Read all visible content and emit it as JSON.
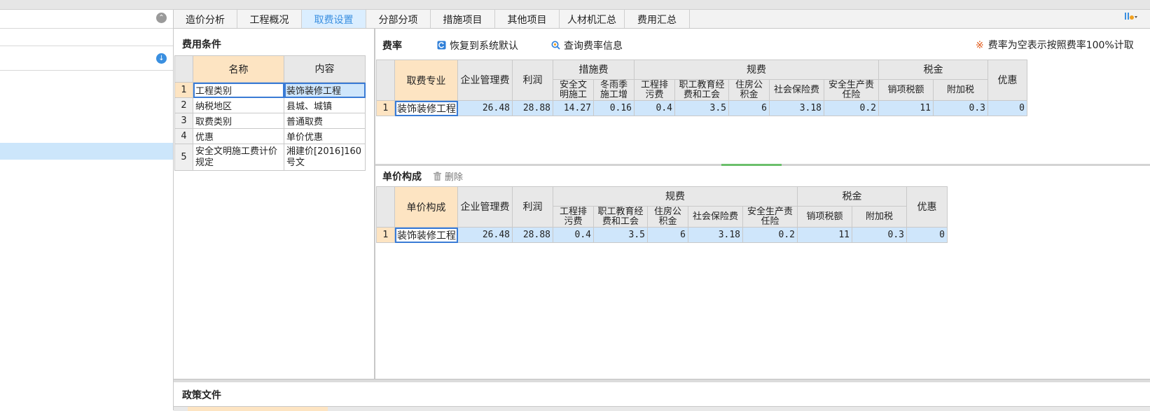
{
  "tabs": [
    {
      "label": "造价分析",
      "active": false
    },
    {
      "label": "工程概况",
      "active": false
    },
    {
      "label": "取费设置",
      "active": true
    },
    {
      "label": "分部分项",
      "active": false
    },
    {
      "label": "措施项目",
      "active": false
    },
    {
      "label": "其他项目",
      "active": false
    },
    {
      "label": "人材机汇总",
      "active": false
    },
    {
      "label": "费用汇总",
      "active": false
    }
  ],
  "conditions": {
    "title": "费用条件",
    "headers": {
      "name": "名称",
      "content": "内容"
    },
    "rows": [
      {
        "no": "1",
        "name": "工程类别",
        "content": "装饰装修工程"
      },
      {
        "no": "2",
        "name": "纳税地区",
        "content": "县城、城镇"
      },
      {
        "no": "3",
        "name": "取费类别",
        "content": "普通取费"
      },
      {
        "no": "4",
        "name": "优惠",
        "content": "单价优惠"
      },
      {
        "no": "5",
        "name": "安全文明施工费计价规定",
        "content": "湘建价[2016]160号文"
      }
    ]
  },
  "rate": {
    "title": "费率",
    "restore_label": "恢复到系统默认",
    "query_label": "查询费率信息",
    "note": "费率为空表示按照费率100%计取",
    "headers": {
      "key": "取费专业",
      "mgmt": "企业管理费",
      "profit": "利润",
      "measures": "措施费",
      "safe_civil": "安全文明施工",
      "winter_rain": "冬雨季施工增",
      "regulatory": "规费",
      "pollution": "工程排污费",
      "edu_union": "职工教育经费和工会",
      "housing": "住房公积金",
      "social": "社会保险费",
      "safety_ins": "安全生产责任险",
      "tax": "税金",
      "output_tax": "销项税额",
      "surtax": "附加税",
      "discount": "优惠"
    },
    "row": {
      "no": "1",
      "key": "装饰装修工程",
      "mgmt": "26.48",
      "profit": "28.88",
      "safe_civil": "14.27",
      "winter_rain": "0.16",
      "pollution": "0.4",
      "edu_union": "3.5",
      "housing": "6",
      "social": "3.18",
      "safety_ins": "0.2",
      "output_tax": "11",
      "surtax": "0.3",
      "discount": "0"
    }
  },
  "unit": {
    "title": "单价构成",
    "delete_label": "删除",
    "headers": {
      "key": "单价构成",
      "mgmt": "企业管理费",
      "profit": "利润",
      "regulatory": "规费",
      "pollution": "工程排污费",
      "edu_union": "职工教育经费和工会",
      "housing": "住房公积金",
      "social": "社会保险费",
      "safety_ins": "安全生产责任险",
      "tax": "税金",
      "output_tax": "销项税额",
      "surtax": "附加税",
      "discount": "优惠"
    },
    "row": {
      "no": "1",
      "key": "装饰装修工程",
      "mgmt": "26.48",
      "profit": "28.88",
      "pollution": "0.4",
      "edu_union": "3.5",
      "housing": "6",
      "social": "3.18",
      "safety_ins": "0.2",
      "output_tax": "11",
      "surtax": "0.3",
      "discount": "0"
    }
  },
  "policy": {
    "title": "政策文件"
  },
  "colors": {
    "accent": "#3a8fe0",
    "header_key": "#fde4c2",
    "selection": "#cfe6fb",
    "note_star": "#e25b1c"
  }
}
